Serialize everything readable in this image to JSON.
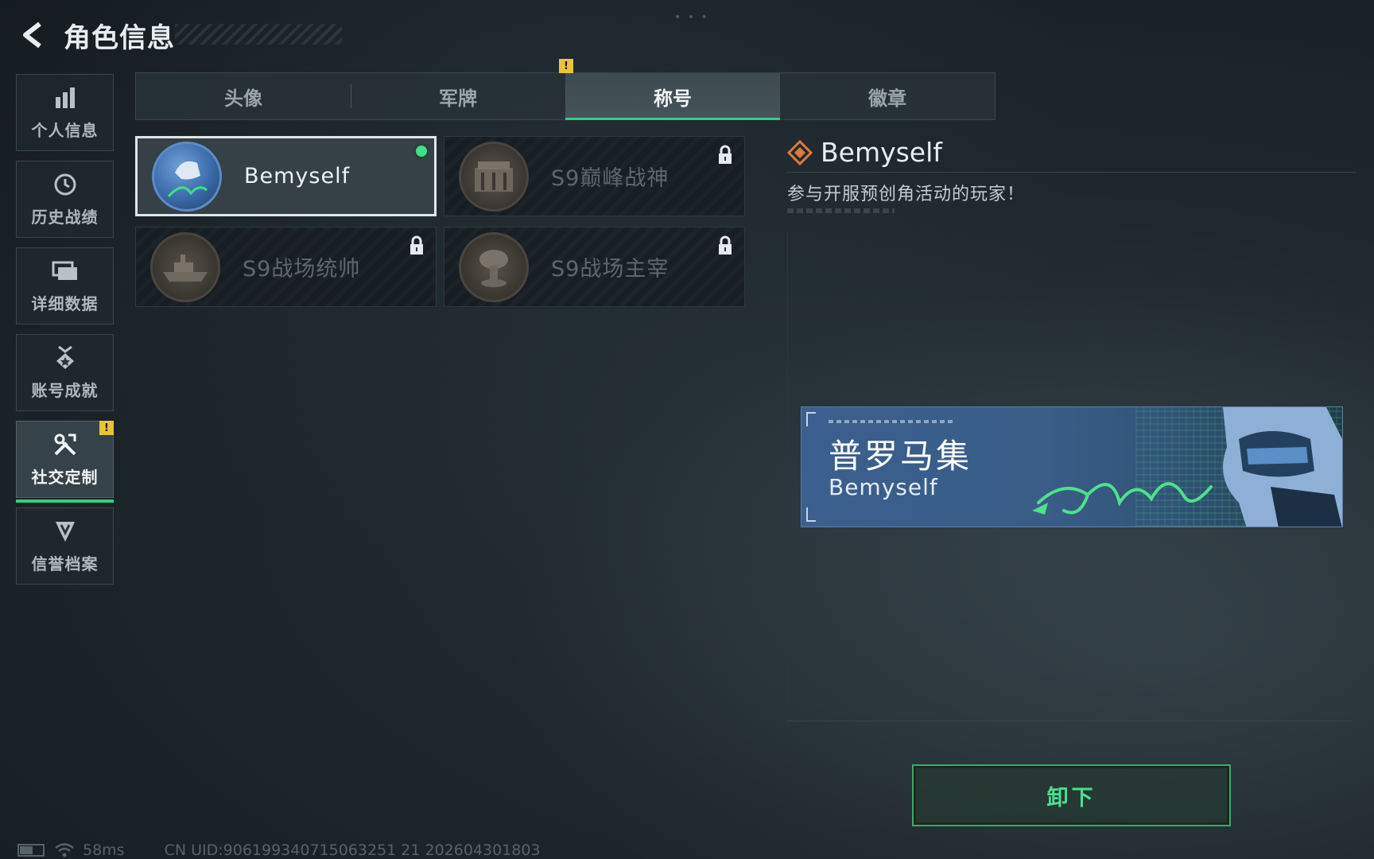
{
  "header": {
    "title": "角色信息"
  },
  "sidebar": {
    "items": [
      {
        "label": "个人信息",
        "icon": "bar-chart-icon"
      },
      {
        "label": "历史战绩",
        "icon": "history-clock-icon"
      },
      {
        "label": "详细数据",
        "icon": "folder-stack-icon"
      },
      {
        "label": "账号成就",
        "icon": "achievement-medal-icon"
      },
      {
        "label": "社交定制",
        "icon": "tools-icon",
        "active": true,
        "badge": "!"
      },
      {
        "label": "信誉档案",
        "icon": "credit-shield-icon"
      }
    ]
  },
  "tabs": {
    "items": [
      {
        "label": "头像"
      },
      {
        "label": "军牌",
        "badge": "!"
      },
      {
        "label": "称号",
        "active": true
      },
      {
        "label": "徽章"
      }
    ]
  },
  "titles": [
    {
      "name": "Bemyself",
      "state": "equipped"
    },
    {
      "name": "S9巅峰战神",
      "state": "locked"
    },
    {
      "name": "S9战场统帅",
      "state": "locked"
    },
    {
      "name": "S9战场主宰",
      "state": "locked"
    }
  ],
  "detail": {
    "name": "Bemyself",
    "description": "参与开服预创角活动的玩家！"
  },
  "banner": {
    "title": "普罗马集",
    "subtitle": "Bemyself"
  },
  "actions": {
    "unequip_label": "卸下"
  },
  "status": {
    "ping": "58ms",
    "uid": "CN UID:906199340715063251 21 202604301803"
  },
  "colors": {
    "accent": "#34d07a",
    "warning": "#e7c43a",
    "detail_icon": "#e07a3a",
    "banner_bg": "#3b5f8e"
  }
}
